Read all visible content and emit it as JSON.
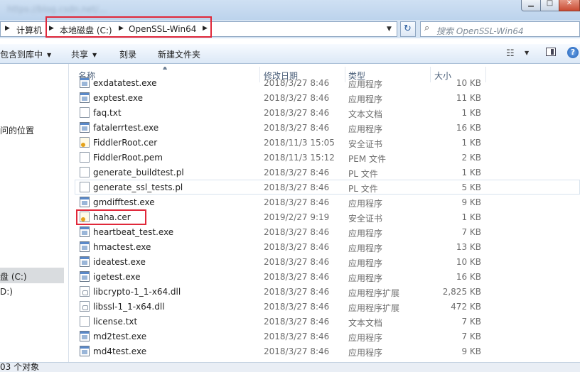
{
  "window": {
    "blurred_title": "https://blog.csdn.net/..."
  },
  "address": {
    "breadcrumbs": [
      "计算机",
      "本地磁盘 (C:)",
      "OpenSSL-Win64"
    ],
    "search_placeholder": "搜索 OpenSSL-Win64"
  },
  "toolbar": {
    "include_library": "包含到库中",
    "share": "共享",
    "burn": "刻录",
    "new_folder": "新建文件夹"
  },
  "nav": {
    "recent_places": "问的位置",
    "local_disk": "盘 (C:)",
    "drive_d": "D:)"
  },
  "columns": {
    "name": "名称",
    "date": "修改日期",
    "type": "类型",
    "size": "大小"
  },
  "files": [
    {
      "name": "exdatatest.exe",
      "date": "2018/3/27 8:46",
      "type": "应用程序",
      "size": "10 KB",
      "icon": "exe"
    },
    {
      "name": "exptest.exe",
      "date": "2018/3/27 8:46",
      "type": "应用程序",
      "size": "11 KB",
      "icon": "exe"
    },
    {
      "name": "faq.txt",
      "date": "2018/3/27 8:46",
      "type": "文本文档",
      "size": "1 KB",
      "icon": "doc"
    },
    {
      "name": "fatalerrtest.exe",
      "date": "2018/3/27 8:46",
      "type": "应用程序",
      "size": "16 KB",
      "icon": "exe"
    },
    {
      "name": "FiddlerRoot.cer",
      "date": "2018/11/3 15:05",
      "type": "安全证书",
      "size": "1 KB",
      "icon": "cert"
    },
    {
      "name": "FiddlerRoot.pem",
      "date": "2018/11/3 15:12",
      "type": "PEM 文件",
      "size": "2 KB",
      "icon": "doc"
    },
    {
      "name": "generate_buildtest.pl",
      "date": "2018/3/27 8:46",
      "type": "PL 文件",
      "size": "1 KB",
      "icon": "doc"
    },
    {
      "name": "generate_ssl_tests.pl",
      "date": "2018/3/27 8:46",
      "type": "PL 文件",
      "size": "5 KB",
      "icon": "doc",
      "hover": true
    },
    {
      "name": "gmdifftest.exe",
      "date": "2018/3/27 8:46",
      "type": "应用程序",
      "size": "9 KB",
      "icon": "exe"
    },
    {
      "name": "haha.cer",
      "date": "2019/2/27 9:19",
      "type": "安全证书",
      "size": "1 KB",
      "icon": "cert"
    },
    {
      "name": "heartbeat_test.exe",
      "date": "2018/3/27 8:46",
      "type": "应用程序",
      "size": "7 KB",
      "icon": "exe"
    },
    {
      "name": "hmactest.exe",
      "date": "2018/3/27 8:46",
      "type": "应用程序",
      "size": "13 KB",
      "icon": "exe"
    },
    {
      "name": "ideatest.exe",
      "date": "2018/3/27 8:46",
      "type": "应用程序",
      "size": "10 KB",
      "icon": "exe"
    },
    {
      "name": "igetest.exe",
      "date": "2018/3/27 8:46",
      "type": "应用程序",
      "size": "16 KB",
      "icon": "exe"
    },
    {
      "name": "libcrypto-1_1-x64.dll",
      "date": "2018/3/27 8:46",
      "type": "应用程序扩展",
      "size": "2,825 KB",
      "icon": "dll"
    },
    {
      "name": "libssl-1_1-x64.dll",
      "date": "2018/3/27 8:46",
      "type": "应用程序扩展",
      "size": "472 KB",
      "icon": "dll"
    },
    {
      "name": "license.txt",
      "date": "2018/3/27 8:46",
      "type": "文本文档",
      "size": "7 KB",
      "icon": "doc"
    },
    {
      "name": "md2test.exe",
      "date": "2018/3/27 8:46",
      "type": "应用程序",
      "size": "7 KB",
      "icon": "exe"
    },
    {
      "name": "md4test.exe",
      "date": "2018/3/27 8:46",
      "type": "应用程序",
      "size": "9 KB",
      "icon": "exe"
    }
  ],
  "status": {
    "item_count": "03 个对象"
  },
  "colors": {
    "highlight_box": "#e0283a",
    "toolbar_bg": "#dce8f6"
  }
}
